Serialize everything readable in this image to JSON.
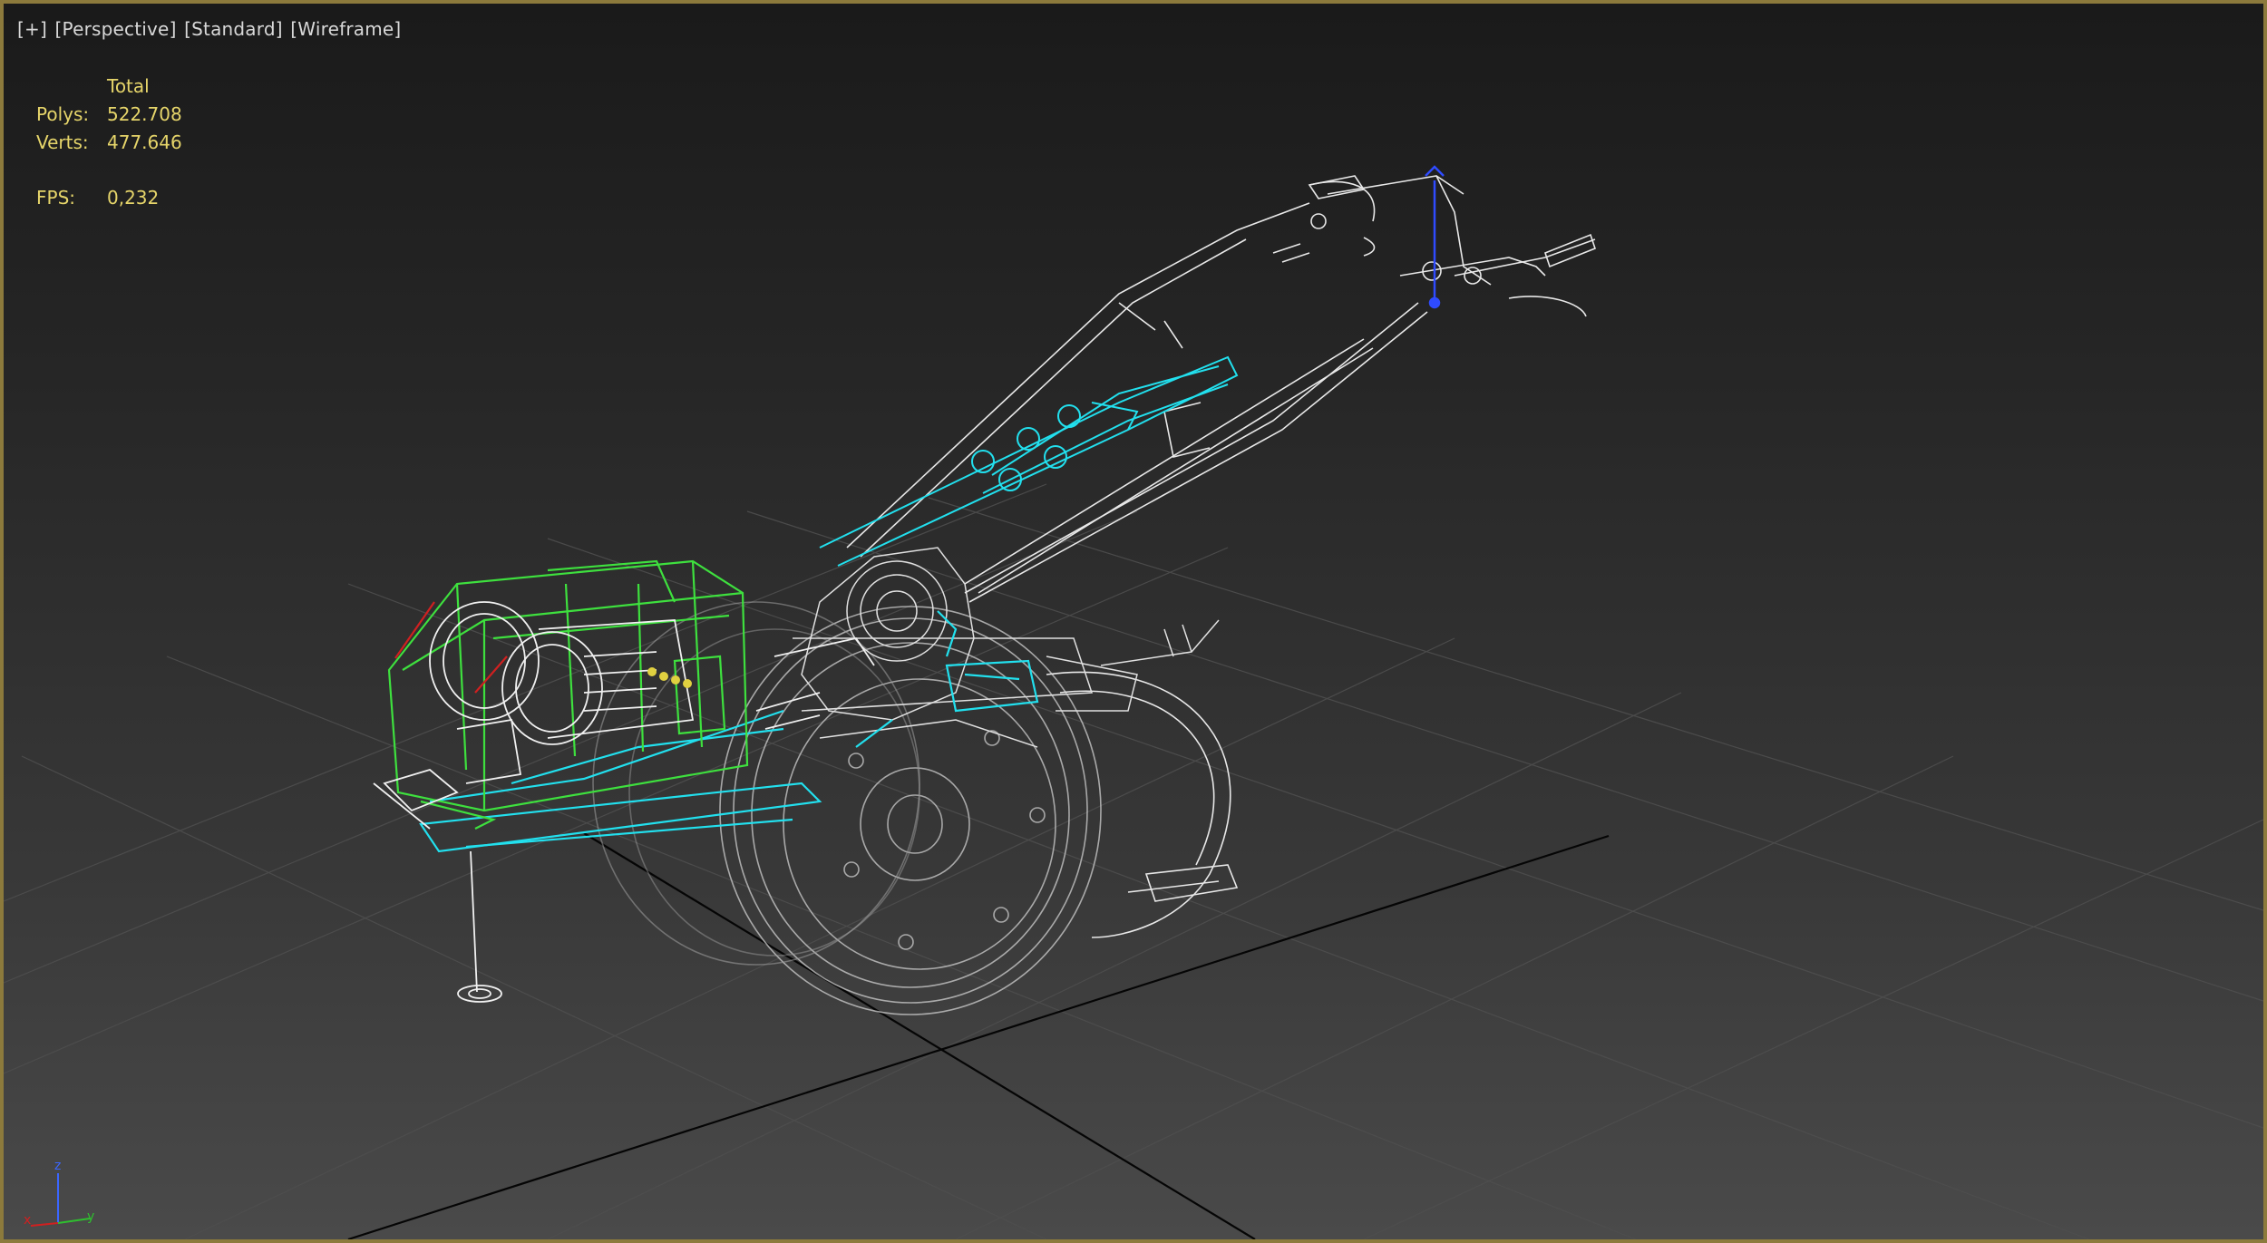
{
  "viewport": {
    "labels": {
      "plus": "[+]",
      "view": "[Perspective]",
      "shading_style": "[Standard]",
      "render_mode": "[Wireframe]"
    },
    "stats": {
      "header": "Total",
      "polys_label": "Polys:",
      "polys_value": "522.708",
      "verts_label": "Verts:",
      "verts_value": "477.646",
      "fps_label": "FPS:",
      "fps_value": "0,232"
    },
    "axis_gizmo": {
      "z": "z",
      "x": "x",
      "y": "y"
    }
  },
  "colors": {
    "viewport_border": "#8c7a3c",
    "stats_text": "#e6d56a",
    "label_text": "#d8d8d8",
    "wire_white": "#e8e8e8",
    "wire_cyan": "#22e0ee",
    "wire_green": "#3ee03e",
    "wire_red": "#d02020",
    "grid_line": "#555555",
    "home_grid": "#050505"
  },
  "scene": {
    "model": "walk-behind tractor / power tiller wireframe",
    "icons": [
      "axis-gizmo-icon",
      "pivot-gizmo-icon"
    ]
  }
}
